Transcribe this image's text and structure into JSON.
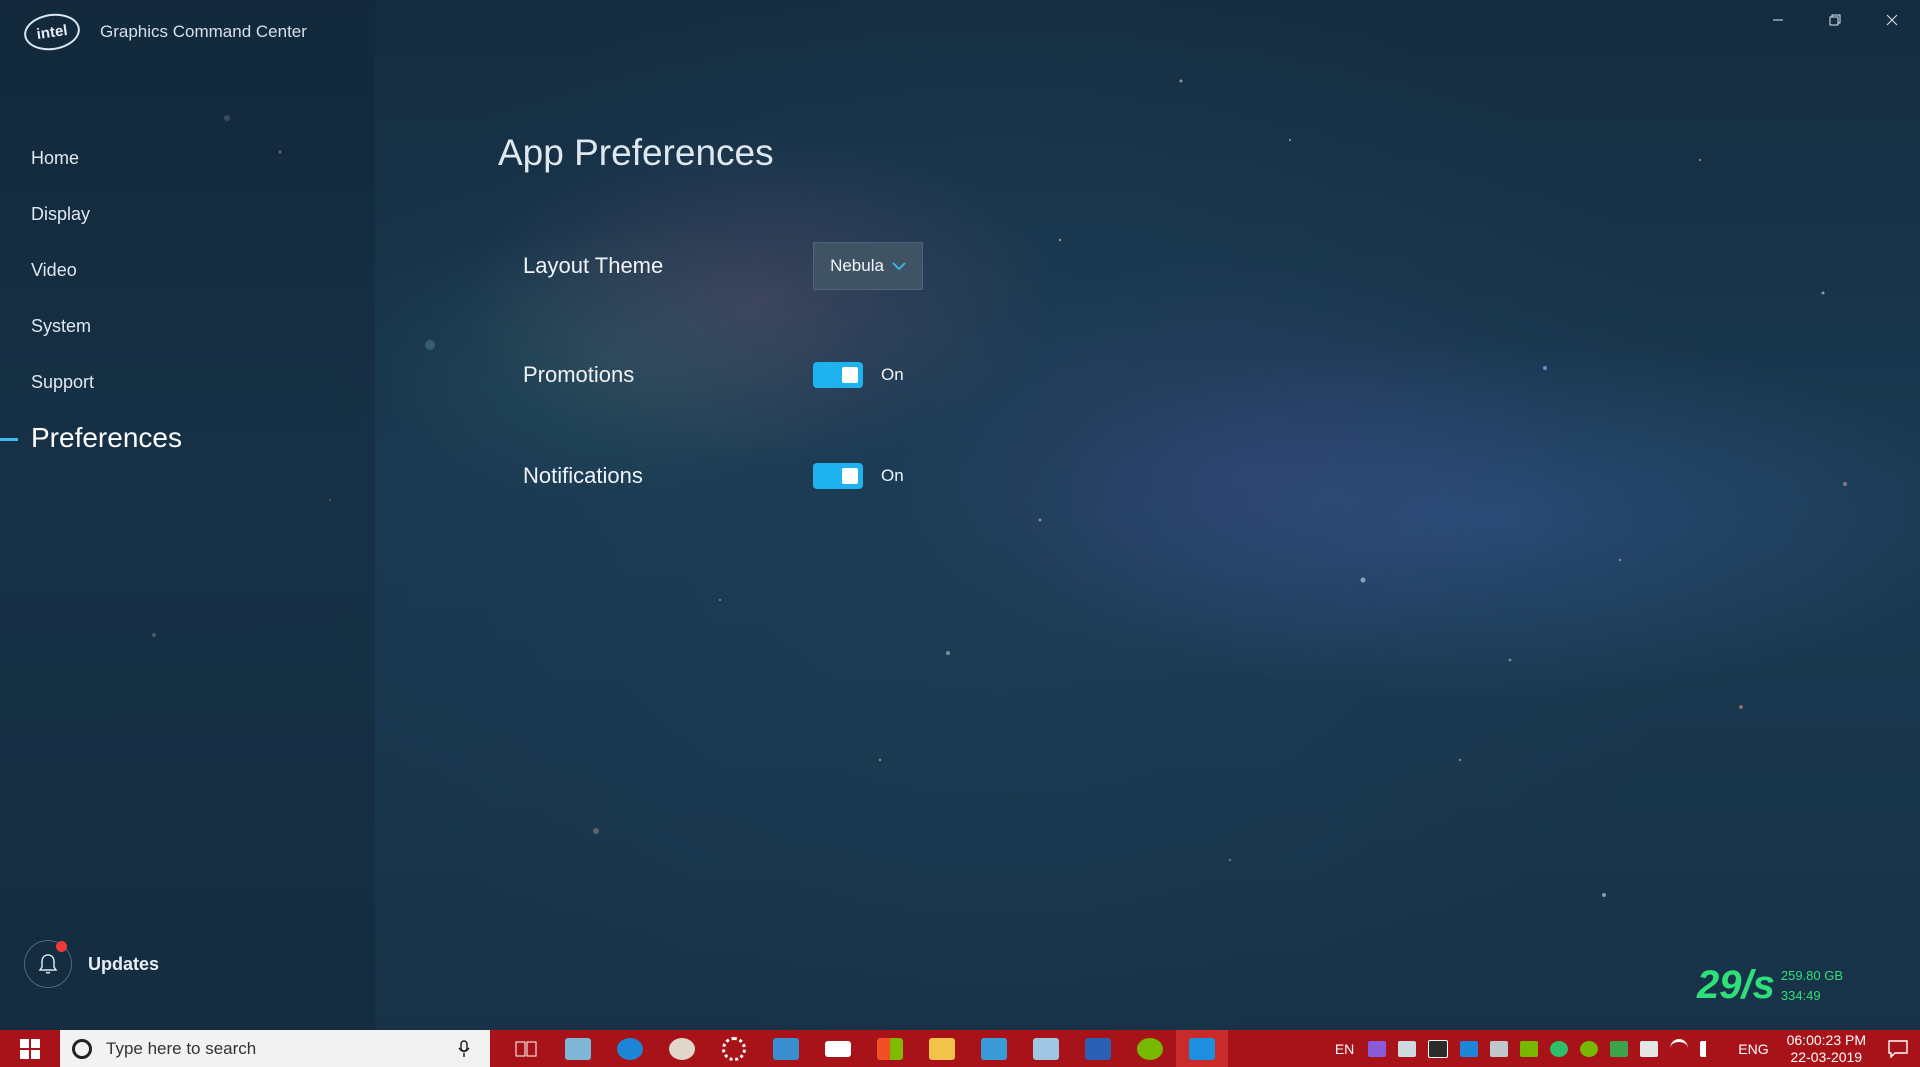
{
  "window": {
    "brand_logo": "intel",
    "title": "Graphics Command Center",
    "controls": {
      "minimize_icon": "minimize-icon",
      "restore_icon": "restore-icon",
      "close_icon": "close-icon"
    }
  },
  "sidebar": {
    "items": [
      {
        "label": "Home"
      },
      {
        "label": "Display"
      },
      {
        "label": "Video"
      },
      {
        "label": "System"
      },
      {
        "label": "Support"
      },
      {
        "label": "Preferences",
        "active": true
      }
    ],
    "updates": {
      "label": "Updates",
      "icon": "bell-icon",
      "has_alert": true
    }
  },
  "main": {
    "title": "App Preferences",
    "settings": {
      "layout_theme": {
        "label": "Layout Theme",
        "value": "Nebula"
      },
      "promotions": {
        "label": "Promotions",
        "state": "On",
        "enabled": true
      },
      "notifications": {
        "label": "Notifications",
        "state": "On",
        "enabled": true
      }
    }
  },
  "netspeed": {
    "rate": "29/s",
    "total": "259.80 GB",
    "time": "334:49"
  },
  "taskbar": {
    "search_placeholder": "Type here to search",
    "tray": {
      "lang1": "EN",
      "lang2": "ENG",
      "time": "06:00:23 PM",
      "date": "22-03-2019"
    }
  },
  "colors": {
    "accent": "#1eb2ee",
    "taskbar": "#a8131a",
    "netspeed": "#2fe07a",
    "alert": "#f03a3a"
  }
}
